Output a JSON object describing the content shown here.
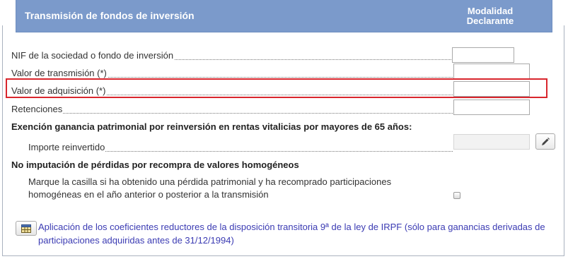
{
  "header": {
    "title": "Transmisión de fondos de inversión",
    "column_line1": "Modalidad",
    "column_line2": "Declarante"
  },
  "fields": {
    "nif": {
      "label": "NIF de la sociedad o fondo de inversión",
      "value": ""
    },
    "valor_transmision": {
      "label": "Valor de transmisión (*)",
      "value": ""
    },
    "valor_adquisicion": {
      "label": "Valor de adquisición (*)",
      "value": ""
    },
    "retenciones": {
      "label": "Retenciones",
      "value": ""
    }
  },
  "exencion": {
    "title": "Exención ganancia patrimonial por reinversión en rentas vitalicias por mayores de 65 años:",
    "importe_label": "Importe reinvertido",
    "importe_value": ""
  },
  "no_imputacion": {
    "title": "No imputación de pérdidas por recompra de valores homogéneos",
    "description": "Marque la casilla si ha obtenido una pérdida patrimonial y ha recomprado participaciones homogéneas en el año anterior o posterior a la transmisión",
    "checked": false
  },
  "link": {
    "text": "Aplicación de los coeficientes reductores de la disposición transitoria 9ª de la ley de IRPF (sólo para ganancias derivadas de participaciones adquiridas antes de 31/12/1994)"
  },
  "colors": {
    "header_bg": "#7b9acb",
    "highlight": "#d9262d",
    "link": "#3b3bb3"
  },
  "icons": {
    "edit": "pencil-icon",
    "table": "table-icon"
  }
}
